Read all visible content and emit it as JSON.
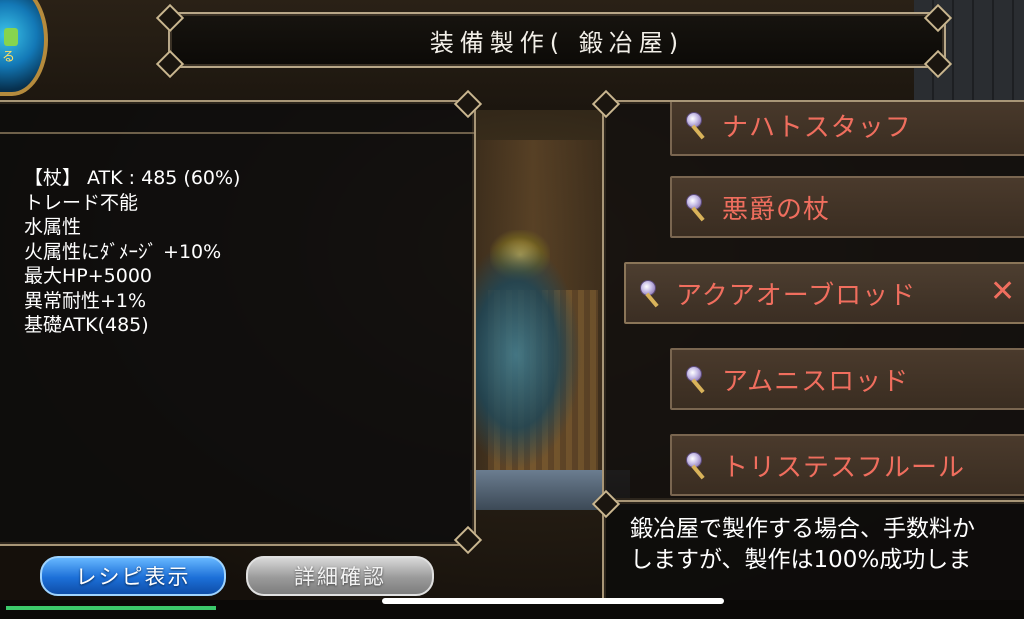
{
  "header": {
    "title": "装備製作( 鍛冶屋)"
  },
  "orb": {
    "label": "る"
  },
  "info": {
    "lines": [
      "【杖】 ATK : 485 (60%)",
      "トレード不能",
      "水属性",
      "火属性にﾀﾞﾒｰｼﾞ +10%",
      "最大HP+5000",
      "異常耐性+1%",
      "基礎ATK(485)"
    ]
  },
  "recipes": [
    {
      "label": "ナハトスタッフ",
      "icon": "staff-icon"
    },
    {
      "label": "悪爵の杖",
      "icon": "staff-icon"
    },
    {
      "label": "アクアオーブロッド",
      "icon": "staff-icon",
      "selected": true
    },
    {
      "label": "アムニスロッド",
      "icon": "staff-icon"
    },
    {
      "label": "トリステスフルール",
      "icon": "staff-icon"
    }
  ],
  "close_symbol": "✕",
  "description": {
    "line1": "鍛冶屋で製作する場合、手数料か",
    "line2": "しますが、製作は100%成功しま"
  },
  "buttons": {
    "recipe_label": "レシピ表示",
    "detail_label": "詳細確認"
  },
  "progress": {
    "value": 1.0
  },
  "colors": {
    "recipe_text": "#f06e5e",
    "button_blue": "#1c6fd8",
    "button_gray": "#9a9a9a",
    "frame": "#a89677"
  }
}
